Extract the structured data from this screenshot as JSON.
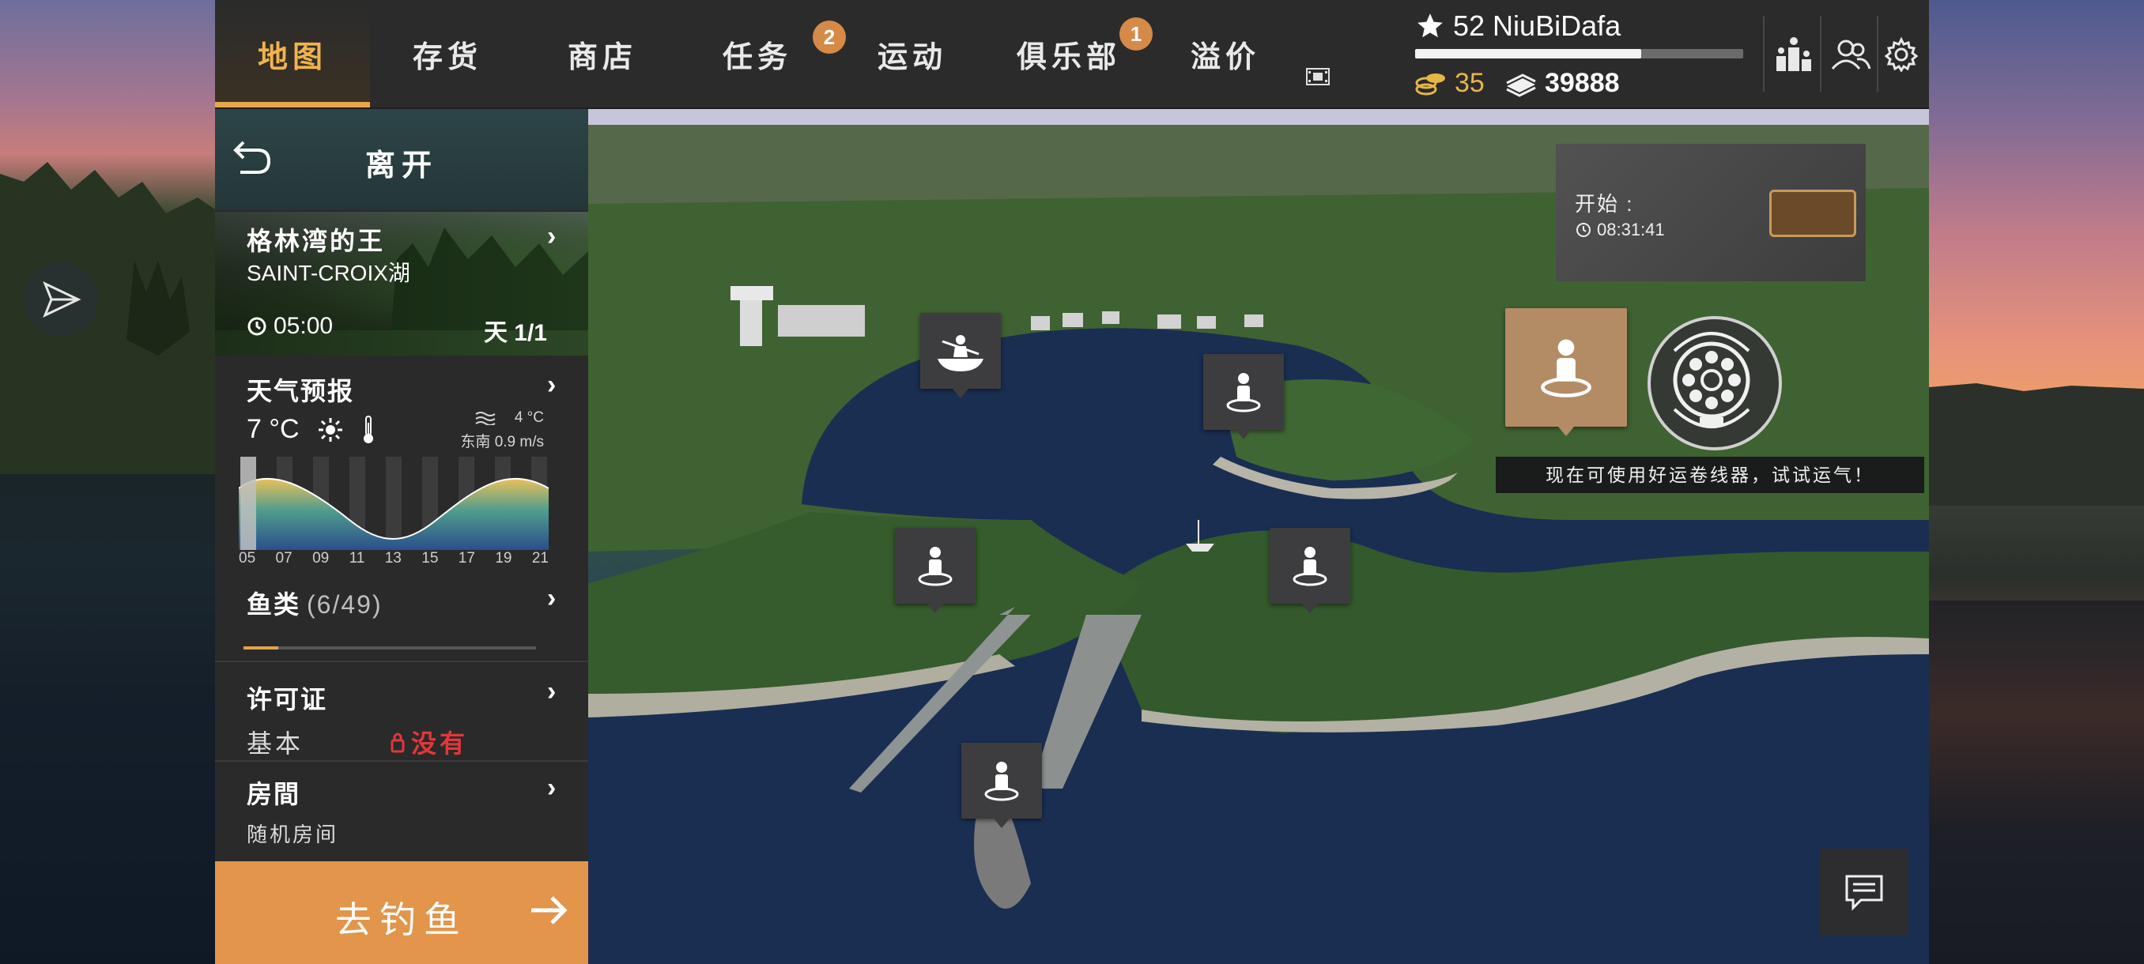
{
  "nav": {
    "tabs": [
      {
        "label": "地图",
        "active": true
      },
      {
        "label": "存货",
        "active": false
      },
      {
        "label": "商店",
        "active": false
      },
      {
        "label": "任务",
        "active": false,
        "badge": "2"
      },
      {
        "label": "运动",
        "active": false
      },
      {
        "label": "俱乐部",
        "active": false,
        "badge": "1"
      },
      {
        "label": "溢价",
        "active": false
      }
    ]
  },
  "player": {
    "level_name": "52 NiuBiDafa",
    "xp_progress": 0.69,
    "gold": "35",
    "cash": "39888"
  },
  "panel": {
    "leave_label": "离开",
    "location": {
      "title": "格林湾的王",
      "lake": "SAINT-CROIX湖",
      "time": "05:00",
      "day": "天 1/1"
    },
    "weather": {
      "title": "天气预报",
      "air_temp": "7 °C",
      "water_temp": "4 °C",
      "wind": "东南 0.9 m/s",
      "hours": [
        "05",
        "07",
        "09",
        "11",
        "13",
        "15",
        "17",
        "19",
        "21"
      ]
    },
    "fish": {
      "title": "鱼类",
      "count": "(6/49)",
      "progress": 0.12
    },
    "license": {
      "title": "许可证",
      "type": "基本",
      "status": "没有"
    },
    "room": {
      "title": "房間",
      "value": "随机房间"
    },
    "go_fishing_label": "去钓鱼"
  },
  "map": {
    "event": {
      "start_label": "开始 :",
      "time": "08:31:41"
    },
    "reel_tip": "现在可使用好运卷线器，试试运气！"
  },
  "colors": {
    "accent": "#e8a54a",
    "go_button": "#e2954b",
    "danger": "#e1373b",
    "gold": "#e6b548"
  }
}
